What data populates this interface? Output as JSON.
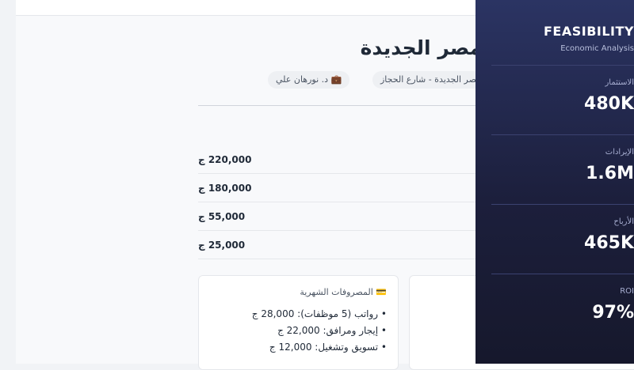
{
  "project": {
    "title": "مصر الجديدة",
    "location_chip": "مصر الجديدة - شارع الحجاز",
    "consultant_chip": "💼 د. نورهان علي"
  },
  "cost_rows": [
    {
      "value": "220,000 ج"
    },
    {
      "value": "180,000 ج"
    },
    {
      "value": "55,000 ج"
    },
    {
      "value": "25,000 ج"
    }
  ],
  "monthly_expenses": {
    "title": "💳 المصروفات الشهرية",
    "items": [
      "رواتب (5 موظفات): 28,000 ج",
      "إيجار ومرافق: 22,000 ج",
      "تسويق وتشغيل: 12,000 ج"
    ]
  },
  "sidebar": {
    "title": "FEASIBILITY",
    "subtitle": "Economic Analysis",
    "metrics": [
      {
        "label": "الاستثمار",
        "value": "480K"
      },
      {
        "label": "الإيرادات",
        "value": "1.6M"
      },
      {
        "label": "الأرباح",
        "value": "465K"
      },
      {
        "label": "ROI",
        "value": "97%"
      }
    ]
  }
}
